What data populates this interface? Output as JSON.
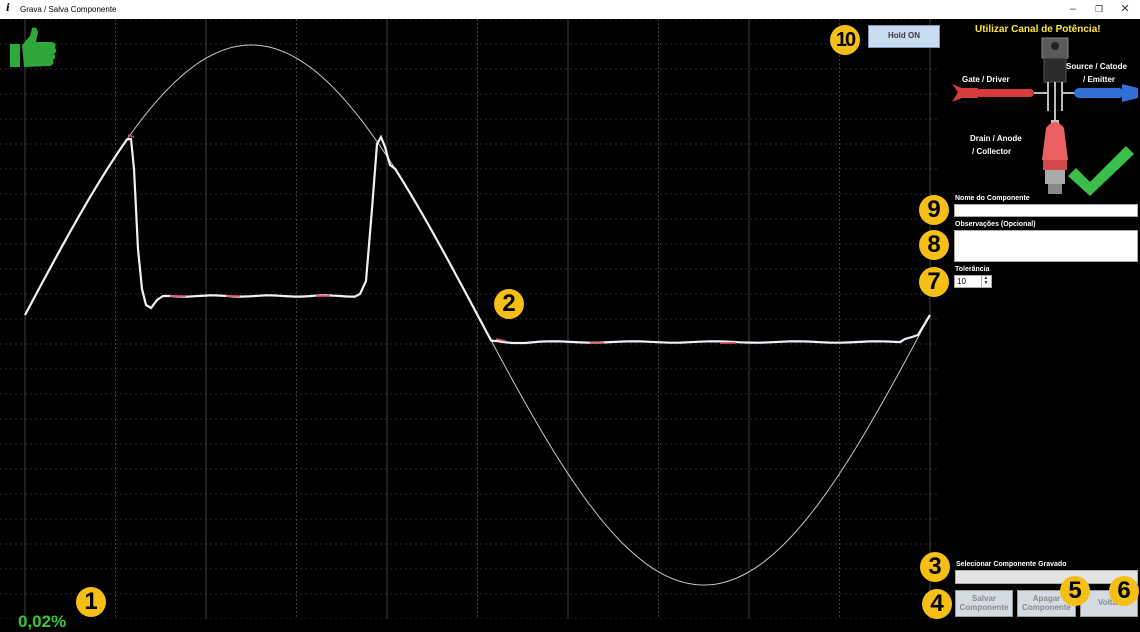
{
  "window": {
    "title": "Grava / Salva Componente",
    "app_icon_glyph": "i",
    "controls": [
      "–",
      "❐",
      "✕"
    ]
  },
  "plot": {
    "background": "#000000",
    "grid_color": "#5a5a5a",
    "reference_color": "#c8c8c8",
    "trace_color": "#f0f0f8",
    "trace_accent_color": "#e05060",
    "percent": "0,02%"
  },
  "hold_button": {
    "label": "Hold ON"
  },
  "probe_panel": {
    "warning": "Utilizar Canal de Potência!",
    "gate_label": "Gate / Driver",
    "source_label_1": "Source / Catode",
    "source_label_2": "/ Emitter",
    "drain_label_1": "Drain / Anode",
    "drain_label_2": "/ Collector"
  },
  "form": {
    "name_label": "Nome do Componente",
    "name_value": "",
    "notes_label": "Observações (Opcional)",
    "notes_value": "",
    "tolerance_label": "Tolerância",
    "tolerance_value": "10",
    "select_label": "Selecionar Componente Gravado",
    "select_value": ""
  },
  "buttons": {
    "save_1": "Salvar",
    "save_2": "Componente",
    "delete_1": "Apagar",
    "delete_2": "Componente",
    "back": "Voltar"
  },
  "callouts": [
    "1",
    "2",
    "3",
    "4",
    "5",
    "6",
    "7",
    "8",
    "9",
    "10"
  ],
  "colors": {
    "callout": "#f5bf16",
    "check": "#3cbf4a",
    "thumb": "#2ea83a",
    "percent": "#35c83a",
    "warning_text": "#ffe83a"
  },
  "icons": {
    "thumb": "thumbs-up-icon",
    "check": "check-icon",
    "component": "transistor-icon"
  }
}
